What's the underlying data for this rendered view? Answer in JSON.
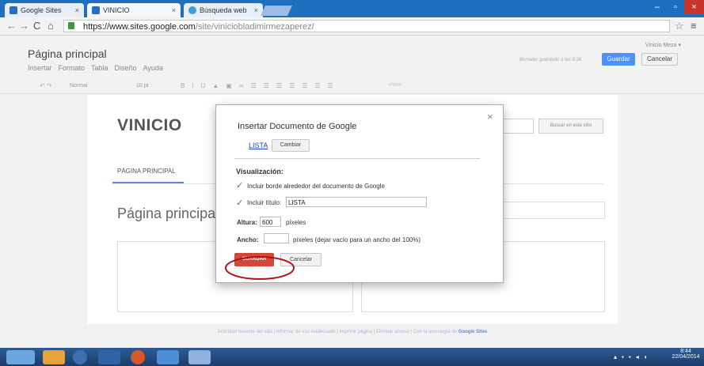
{
  "browser": {
    "tabs": [
      {
        "label": "Google Sites",
        "close": "×"
      },
      {
        "label": "VINICIO",
        "close": "×"
      },
      {
        "label": "Búsqueda web",
        "close": "×"
      }
    ],
    "url_host": "https://www.sites.google.com",
    "url_path": "/site/viniciobladimirmezaperez/",
    "win_min": "–",
    "win_max": "▫",
    "win_close": "×"
  },
  "editor": {
    "user": "Vinicio Meza ▾",
    "page_title": "Página principal",
    "menu": [
      "Insertar",
      "Formato",
      "Tabla",
      "Diseño",
      "Ayuda"
    ],
    "draft_status": "Borrador guardado a las 8:38",
    "save_label": "Guardar",
    "cancel_label": "Cancelar",
    "toolbar": {
      "style": "Normal",
      "size": "10 pt",
      "html": "<html>"
    }
  },
  "site": {
    "title": "VINICIO",
    "search_button": "Buscar en este sitio",
    "nav_tab": "PÁGINA PRINCIPAL",
    "heading": "Página principa",
    "footer_text": "Actividad reciente del sitio  |  Informar de uso inadecuado  |  Imprimir página  |  Eliminar acceso  |  Con la tecnología de",
    "footer_brand": "Google Sites"
  },
  "dialog": {
    "title": "Insertar Documento de Google",
    "close": "×",
    "doc_link": "LISTA",
    "change_button": "Cambiar",
    "section_label": "Visualización:",
    "border_checkbox": "Incluir borde alrededor del documento de Google",
    "title_checkbox": "Incluir título:",
    "title_value": "LISTA",
    "height_label": "Altura:",
    "height_value": "600",
    "height_unit": "píxeles",
    "width_label": "Ancho:",
    "width_value": "",
    "width_unit": "píxeles  (dejar vacío para un ancho del 100%)",
    "save_button": "GUARDAR",
    "cancel_button": "Cancelar"
  },
  "taskbar": {
    "time": "8:44",
    "date": "22/04/2014"
  },
  "colors": {
    "chrome_tab_bar": "#1f6fc1",
    "accent_blue": "#4d90fe",
    "save_red": "#d14836",
    "annotation_circle": "#b0101e",
    "taskbar": "#1b3d6b"
  }
}
